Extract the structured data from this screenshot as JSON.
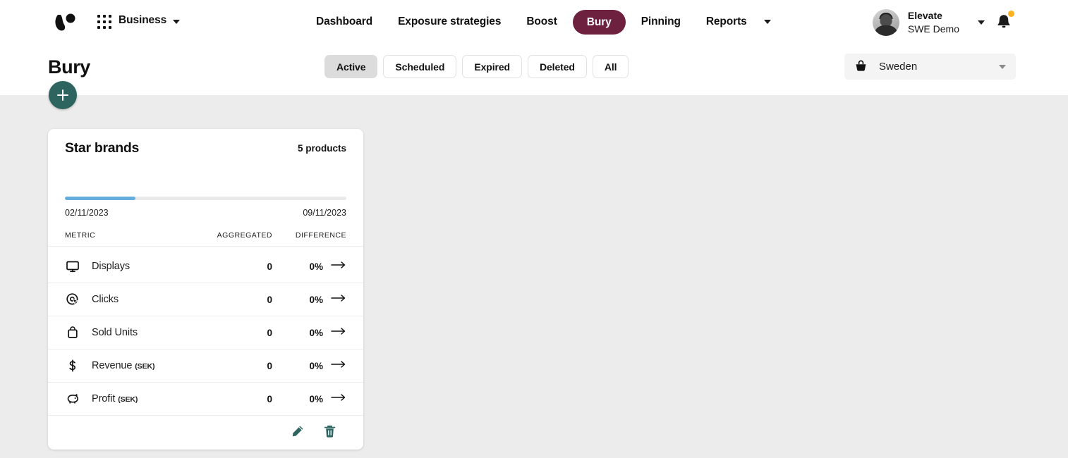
{
  "header": {
    "logo_name": "brand-logo",
    "apps_icon": "apps-grid-icon",
    "business_label": "Business",
    "nav": [
      {
        "label": "Dashboard",
        "active": false
      },
      {
        "label": "Exposure strategies",
        "active": false
      },
      {
        "label": "Boost",
        "active": false
      },
      {
        "label": "Bury",
        "active": true
      },
      {
        "label": "Pinning",
        "active": false
      },
      {
        "label": "Reports",
        "active": false
      }
    ],
    "profile": {
      "name": "Elevate",
      "subtitle": "SWE Demo"
    },
    "notification_icon": "bell-icon",
    "has_notification": true
  },
  "subheader": {
    "page_title": "Bury",
    "add_button_label": "+",
    "filters": [
      {
        "label": "Active",
        "selected": true
      },
      {
        "label": "Scheduled",
        "selected": false
      },
      {
        "label": "Expired",
        "selected": false
      },
      {
        "label": "Deleted",
        "selected": false
      },
      {
        "label": "All",
        "selected": false
      }
    ],
    "country": {
      "icon": "basket-icon",
      "value": "Sweden"
    }
  },
  "card": {
    "title": "Star brands",
    "products_count": "5 products",
    "progress_percent": 25,
    "start_date": "02/11/2023",
    "end_date": "09/11/2023",
    "columns": {
      "metric": "METRIC",
      "aggregated": "AGGREGATED",
      "difference": "DIFFERENCE"
    },
    "metrics": [
      {
        "icon": "monitor-icon",
        "label": "Displays",
        "currency": "",
        "aggregated": "0",
        "difference": "0%",
        "trend": "flat"
      },
      {
        "icon": "click-target-icon",
        "label": "Clicks",
        "currency": "",
        "aggregated": "0",
        "difference": "0%",
        "trend": "flat"
      },
      {
        "icon": "shopping-bag-icon",
        "label": "Sold Units",
        "currency": "",
        "aggregated": "0",
        "difference": "0%",
        "trend": "flat"
      },
      {
        "icon": "dollar-icon",
        "label": "Revenue",
        "currency": "(SEK)",
        "aggregated": "0",
        "difference": "0%",
        "trend": "flat"
      },
      {
        "icon": "piggy-bank-icon",
        "label": "Profit",
        "currency": "(SEK)",
        "aggregated": "0",
        "difference": "0%",
        "trend": "flat"
      }
    ],
    "edit_action": "edit",
    "delete_action": "delete"
  },
  "colors": {
    "accent_maroon": "#6e203f",
    "accent_teal": "#2e6460",
    "progress_blue": "#63aedd",
    "notification_orange": "#ffb020",
    "page_background": "#ececec"
  }
}
